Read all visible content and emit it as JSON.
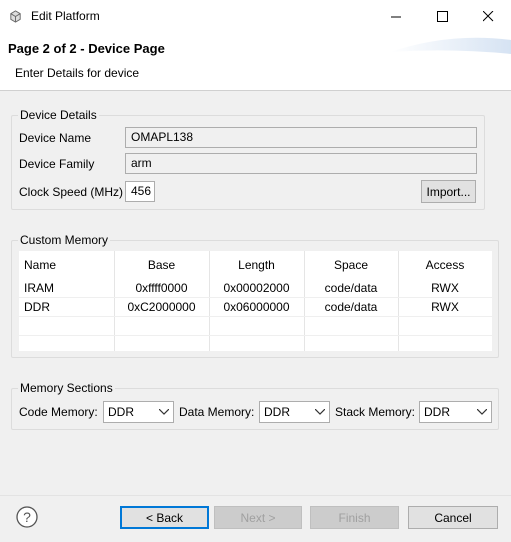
{
  "window": {
    "title": "Edit Platform",
    "icon": "app-gear-icon",
    "minimize": "—",
    "maximize": "☐",
    "close": "✕"
  },
  "banner": {
    "title": "Page 2 of 2 - Device Page",
    "subtitle": "Enter Details for device"
  },
  "device_details": {
    "group_label": "Device Details",
    "name_label": "Device Name",
    "name_value": "OMAPL138",
    "family_label": "Device Family",
    "family_value": "arm",
    "clock_label": "Clock Speed (MHz)",
    "clock_value": "456",
    "import_label": "Import..."
  },
  "custom_memory": {
    "group_label": "Custom Memory",
    "columns": [
      "Name",
      "Base",
      "Length",
      "Space",
      "Access"
    ],
    "rows": [
      [
        "IRAM",
        "0xffff0000",
        "0x00002000",
        "code/data",
        "RWX"
      ],
      [
        "DDR",
        "0xC2000000",
        "0x06000000",
        "code/data",
        "RWX"
      ]
    ]
  },
  "memory_sections": {
    "group_label": "Memory Sections",
    "code_label": "Code Memory:",
    "code_value": "DDR",
    "data_label": "Data Memory:",
    "data_value": "DDR",
    "stack_label": "Stack Memory:",
    "stack_value": "DDR"
  },
  "footer": {
    "help_icon": "question-mark-icon",
    "back_label": "< Back",
    "next_label": "Next >",
    "finish_label": "Finish",
    "cancel_label": "Cancel"
  }
}
